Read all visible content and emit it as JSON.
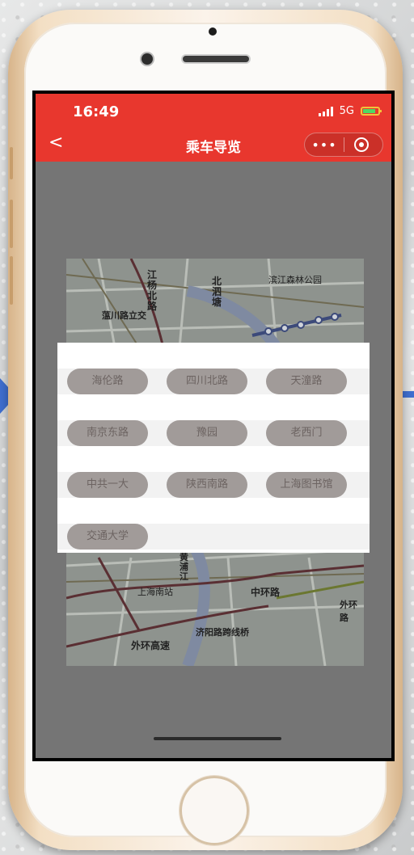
{
  "status_bar": {
    "time": "16:49",
    "network": "5G"
  },
  "nav": {
    "back_label": "<",
    "title": "乘车导览",
    "more_label": "•••"
  },
  "map": {
    "labels": [
      "江杨北路",
      "北泗塘",
      "蕰川路立交",
      "滨江森林公园",
      "上海南站",
      "中环路",
      "外环高速",
      "济阳路跨线桥",
      "外环路",
      "黄浦江"
    ]
  },
  "stations": [
    [
      "海伦路",
      "四川北路",
      "天潼路"
    ],
    [
      "南京东路",
      "豫园",
      "老西门"
    ],
    [
      "中共一大",
      "陕西南路",
      "上海图书馆"
    ],
    [
      "交通大学"
    ]
  ],
  "colors": {
    "header": "#e8372e",
    "pill": "#a19b99",
    "pill_text": "#6d6462",
    "arrow": "#3f6fd0"
  }
}
